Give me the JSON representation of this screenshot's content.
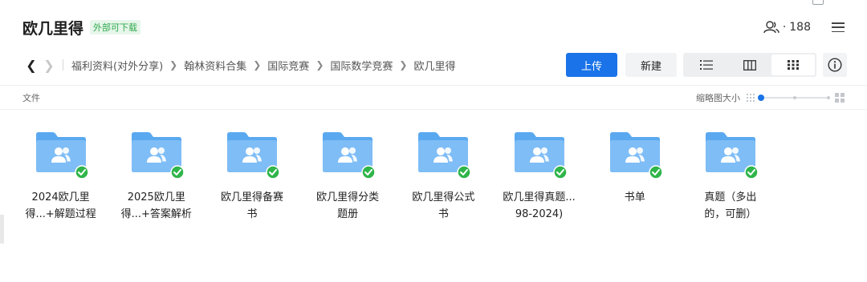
{
  "header": {
    "title": "欧几里得",
    "badge": "外部可下载",
    "member_count": "188"
  },
  "nav": {
    "breadcrumbs": [
      "福利资料(对外分享)",
      "翰林资料合集",
      "国际竞赛",
      "国际数学竞赛",
      "欧几里得"
    ]
  },
  "actions": {
    "upload_label": "上传",
    "new_label": "新建",
    "views": [
      "list-view-icon",
      "column-view-icon",
      "grid-view-icon"
    ],
    "active_view": "grid-view-icon"
  },
  "list_header": {
    "column_label": "文件",
    "thumb_size_label": "缩略图大小",
    "thumb_size_level": 0
  },
  "folders": [
    {
      "name": "2024欧几里\n得...+解题过程"
    },
    {
      "name": "2025欧几里\n得...+答案解析"
    },
    {
      "name": "欧几里得备赛\n书"
    },
    {
      "name": "欧几里得分类\n题册"
    },
    {
      "name": "欧几里得公式\n书"
    },
    {
      "name": "欧几里得真题...\n98-2024)"
    },
    {
      "name": "书单"
    },
    {
      "name": "真题（多出\n的，可删）"
    }
  ],
  "colors": {
    "accent": "#1a73e8",
    "folder": "#5aa9f0",
    "folder_light": "#84c1f7",
    "check": "#2fb54a",
    "badge_text": "#2ea84c"
  }
}
